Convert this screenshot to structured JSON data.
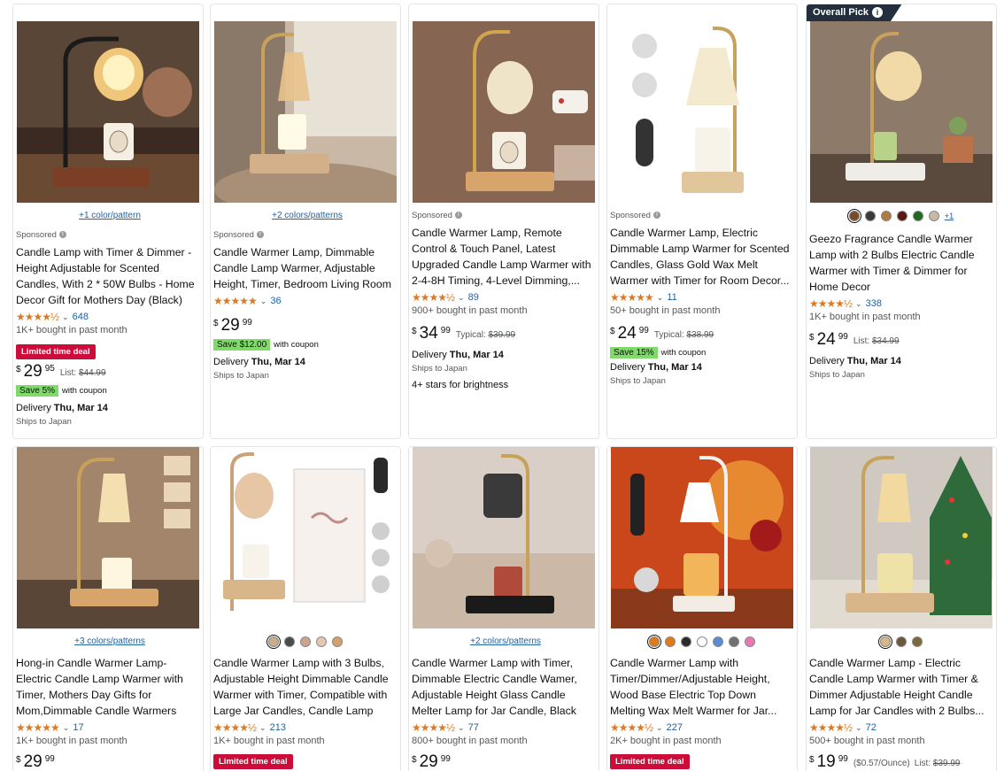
{
  "products": [
    {
      "colors_link": "+1 color/pattern",
      "sponsored": "Sponsored",
      "title": "Candle Lamp with Timer & Dimmer - Height Adjustable for Scented Candles, With 2 * 50W Bulbs - Home Decor Gift for Mothers Day (Black)",
      "stars": "★★★★½",
      "rating_count": "648",
      "bought": "1K+ bought in past month",
      "deal": "Limited time deal",
      "price_whole": "29",
      "price_frac": "95",
      "list_label": "List:",
      "list_price": "$44.99",
      "save": "Save 5%",
      "coupon_text": "with coupon",
      "delivery_label": "Delivery",
      "delivery_date": "Thu, Mar 14",
      "ships": "Ships to Japan"
    },
    {
      "colors_link": "+2 colors/patterns",
      "sponsored": "Sponsored",
      "title": "Candle Warmer Lamp, Dimmable Candle Lamp Warmer, Adjustable Height, Timer, Bedroom Living Room Home Decor Wax Melt Warmer for...",
      "stars": "★★★★★",
      "rating_count": "36",
      "price_whole": "29",
      "price_frac": "99",
      "save": "Save $12.00",
      "coupon_text": "with coupon",
      "delivery_label": "Delivery",
      "delivery_date": "Thu, Mar 14",
      "ships": "Ships to Japan"
    },
    {
      "sponsored": "Sponsored",
      "title": "Candle Warmer Lamp, Remote Control & Touch Panel, Latest Upgraded Candle Lamp Warmer with 2-4-8H Timing, 4-Level Dimming,...",
      "stars": "★★★★½",
      "rating_count": "89",
      "bought": "900+ bought in past month",
      "price_whole": "34",
      "price_frac": "99",
      "list_label": "Typical:",
      "list_price": "$39.99",
      "delivery_label": "Delivery",
      "delivery_date": "Thu, Mar 14",
      "ships": "Ships to Japan",
      "extra": "4+ stars for brightness"
    },
    {
      "sponsored": "Sponsored",
      "title": "Candle Warmer Lamp, Electric Dimmable Lamp Warmer for Scented Candles, Glass Gold Wax Melt Warmer with Timer for Room Decor...",
      "stars": "★★★★★",
      "rating_count": "11",
      "bought": "50+ bought in past month",
      "price_whole": "24",
      "price_frac": "99",
      "list_label": "Typical:",
      "list_price": "$38.99",
      "save": "Save 15%",
      "coupon_text": "with coupon",
      "delivery_label": "Delivery",
      "delivery_date": "Thu, Mar 14",
      "ships": "Ships to Japan"
    },
    {
      "badge": "Overall Pick",
      "badge_icon": "i",
      "swatch_more": "+1",
      "title": "Geezo Fragrance Candle Warmer Lamp with 2 Bulbs Electric Candle Warmer with Timer & Dimmer for Home Decor",
      "stars": "★★★★½",
      "rating_count": "338",
      "bought": "1K+ bought in past month",
      "price_whole": "24",
      "price_frac": "99",
      "list_label": "List:",
      "list_price": "$34.99",
      "delivery_label": "Delivery",
      "delivery_date": "Thu, Mar 14",
      "ships": "Ships to Japan"
    },
    {
      "colors_link": "+3 colors/patterns",
      "title": "Hong-in Candle Warmer Lamp-Electric Candle Lamp Warmer with Timer, Mothers Day Gifts for Mom,Dimmable Candle Warmers fo...",
      "stars": "★★★★★",
      "rating_count": "17",
      "bought": "1K+ bought in past month",
      "price_whole": "29",
      "price_frac": "99"
    },
    {
      "title": "Candle Warmer Lamp with 3 Bulbs, Adjustable Height Dimmable Candle Warmer with Timer, Compatible with Large Jar Candles, Candle Lamp wit...",
      "stars": "★★★★½",
      "rating_count": "213",
      "bought": "1K+ bought in past month",
      "deal": "Limited time deal"
    },
    {
      "colors_link": "+2 colors/patterns",
      "title": "Candle Warmer Lamp with Timer, Dimmable Electric Candle Wamer, Adjustable Height Glass Candle Melter Lamp for Jar Candle, Black",
      "stars": "★★★★½",
      "rating_count": "77",
      "bought": "800+ bought in past month",
      "price_whole": "29",
      "price_frac": "99"
    },
    {
      "title": "Candle Warmer Lamp with Timer/Dimmer/Adjustable Height, Wood Base Electric Top Down Melting Wax Melt Warmer for Jar...",
      "stars": "★★★★½",
      "rating_count": "227",
      "bought": "2K+ bought in past month",
      "deal": "Limited time deal"
    },
    {
      "title": "Candle Warmer Lamp - Electric Candle Lamp Warmer with Timer & Dimmer Adjustable Height Candle Lamp for Jar Candles with 2 Bulbs...",
      "stars": "★★★★½",
      "rating_count": "72",
      "bought": "500+ bought in past month",
      "price_whole": "19",
      "price_frac": "99",
      "unit_price": "($0.57/Ounce)",
      "list_label": "List:",
      "list_price": "$39.99"
    }
  ],
  "currency": "$",
  "chevron": "⌄",
  "colors": {
    "star": "#de7921",
    "link": "#2162a1",
    "deal": "#cc0c39",
    "save_bg": "#7fda69",
    "badge": "#232f3e"
  },
  "swatches": {
    "p5": [
      "#7a4a2b",
      "#3a3a3a",
      "#b07a3f",
      "#5a1a12",
      "#1e6a1e",
      "#c9b8a8"
    ],
    "p7": [
      "#c9ae8a",
      "#4a4a4a",
      "#c9a58f",
      "#e3c8b5",
      "#d4a06b"
    ],
    "p9": [
      "#e07a14",
      "#e07a14",
      "#2a2a2a",
      "#ffffff",
      "#5b8bd0",
      "#707070",
      "#e87ab0"
    ],
    "p10": [
      "#d9b68a",
      "#6a5a3a",
      "#7a6a3a"
    ]
  }
}
